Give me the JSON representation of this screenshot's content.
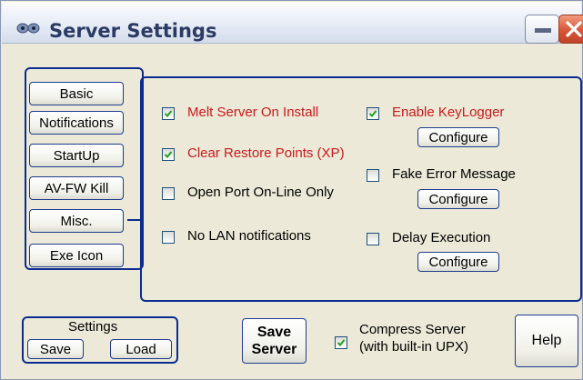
{
  "window": {
    "title": "Server Settings",
    "minimize_icon": "minimize-icon",
    "close_icon": "close-icon",
    "app_icon": "alien-eyes-icon"
  },
  "nav_buttons": [
    "Basic",
    "Notifications",
    "StartUp",
    "AV-FW Kill",
    "Misc.",
    "Exe Icon"
  ],
  "selected_nav": "Misc.",
  "options": {
    "melt_server": {
      "label": "Melt Server On Install",
      "checked": true
    },
    "clear_restore": {
      "label": "Clear Restore Points (XP)",
      "checked": true
    },
    "open_port": {
      "label": "Open Port On-Line Only",
      "checked": false
    },
    "no_lan": {
      "label": "No LAN notifications",
      "checked": false
    },
    "keylogger": {
      "label": "Enable KeyLogger",
      "checked": true,
      "configure": "Configure"
    },
    "fake_error": {
      "label": "Fake Error Message",
      "checked": false,
      "configure": "Configure"
    },
    "delay_exec": {
      "label": "Delay Execution",
      "checked": false,
      "configure": "Configure"
    }
  },
  "settings_group": {
    "label": "Settings",
    "save": "Save",
    "load": "Load"
  },
  "save_server": {
    "line1": "Save",
    "line2": "Server"
  },
  "compress": {
    "line1": "Compress Server",
    "line2": "(with built-in UPX)",
    "checked": true
  },
  "help": "Help",
  "colors": {
    "accent": "#0b2c8f",
    "red_text": "#cc1a1a",
    "background": "#ece9d8"
  }
}
